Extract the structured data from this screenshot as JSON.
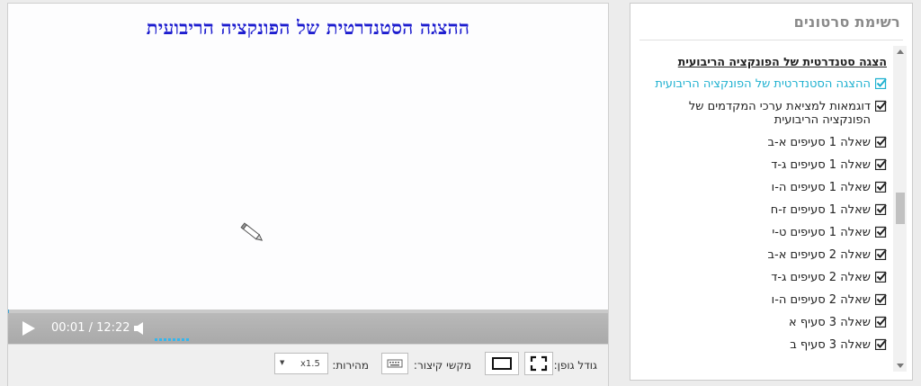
{
  "player": {
    "video_title": "ההצגה הסטנדרטית של הפונקציה הריבועית",
    "time_display": "00:01 / 12:22",
    "progress_fraction": 0.001,
    "volume_fraction": 1.0
  },
  "toolbar": {
    "font_size_label": "גודל גופן:",
    "shortcuts_label": "מקשי קיצור:",
    "speed_label": "מהירות:",
    "speed_value": "x1.5"
  },
  "playlist": {
    "title": "רשימת סרטונים",
    "section_heading": "הצגה סטנדרטית של הפונקציה הריבועית",
    "items": [
      {
        "label": "ההצגה הסטנדרטית של הפונקציה הריבועית",
        "active": true
      },
      {
        "label": "דוגמאות למציאת ערכי המקדמים של הפונקציה הריבועית",
        "active": false
      },
      {
        "label": "שאלה 1 סעיפים א-ב",
        "active": false
      },
      {
        "label": "שאלה 1 סעיפים ג-ד",
        "active": false
      },
      {
        "label": "שאלה 1 סעיפים ה-ו",
        "active": false
      },
      {
        "label": "שאלה 1 סעיפים ז-ח",
        "active": false
      },
      {
        "label": "שאלה 1 סעיפים ט-י",
        "active": false
      },
      {
        "label": "שאלה 2 סעיפים א-ב",
        "active": false
      },
      {
        "label": "שאלה 2 סעיפים ג-ד",
        "active": false
      },
      {
        "label": "שאלה 2 סעיפים ה-ו",
        "active": false
      },
      {
        "label": "שאלה 3 סעיף א",
        "active": false
      },
      {
        "label": "שאלה 3 סעיף ב",
        "active": false
      }
    ]
  },
  "colors": {
    "title_blue": "#1d1dcf",
    "active_item": "#1fb1d0",
    "volume": "#34b6ee"
  },
  "icons": {
    "play": "play-icon",
    "volume": "speaker-icon",
    "cursor": "pen-cursor-icon",
    "checkbox": "checked-checkbox-icon",
    "keyboard": "keyboard-icon",
    "fullscreen": "fullscreen-icon",
    "normal_size": "normal-size-icon"
  }
}
